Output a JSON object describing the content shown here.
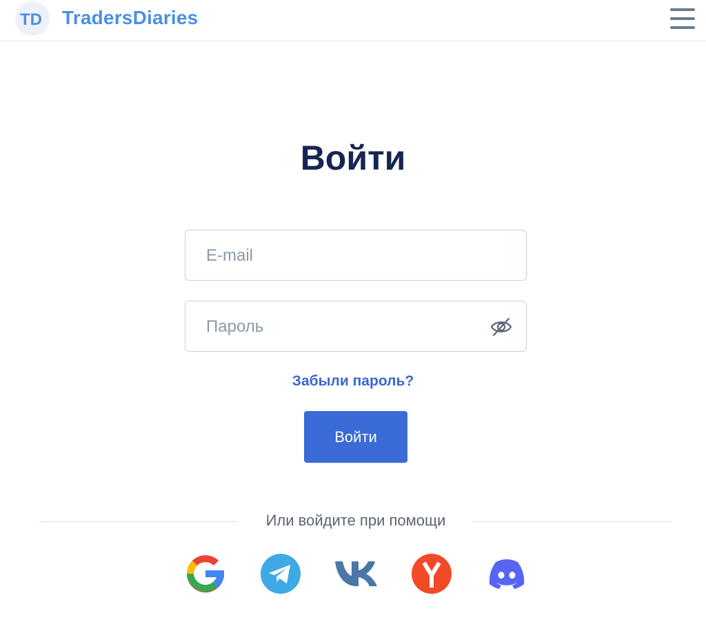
{
  "header": {
    "logo_monogram": "TD",
    "logo_text": "TradersDiaries",
    "menu_icon": "hamburger-menu-icon"
  },
  "login": {
    "title": "Войти",
    "email_placeholder": "E-mail",
    "password_placeholder": "Пароль",
    "password_toggle_icon": "eye-slash-icon",
    "forgot_password": "Забыли пароль?",
    "submit_label": "Войти"
  },
  "social": {
    "divider_text": "Или войдите при помощи",
    "providers": [
      {
        "name": "google",
        "icon": "google-icon"
      },
      {
        "name": "telegram",
        "icon": "telegram-icon"
      },
      {
        "name": "vk",
        "icon": "vk-icon"
      },
      {
        "name": "yandex",
        "icon": "yandex-icon"
      },
      {
        "name": "discord",
        "icon": "discord-icon"
      }
    ]
  },
  "colors": {
    "accent": "#3a6bd6",
    "link": "#3a67cf",
    "logo": "#4a90e2",
    "title": "#172554"
  }
}
